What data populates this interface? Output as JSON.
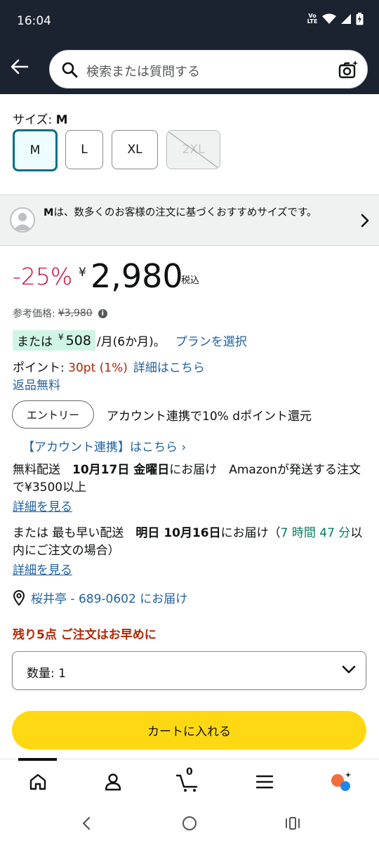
{
  "status_bar": {
    "time": "16:04",
    "volte_line1": "Vo",
    "volte_line2": "LTE"
  },
  "search": {
    "placeholder": "検索または質問する"
  },
  "size": {
    "label_prefix": "サイズ: ",
    "selected": "M",
    "options": [
      {
        "label": "M",
        "state": "selected"
      },
      {
        "label": "L",
        "state": "available"
      },
      {
        "label": "XL",
        "state": "available"
      },
      {
        "label": "2XL",
        "state": "unavailable"
      }
    ]
  },
  "recommendation": {
    "size": "M",
    "text": "は、数多くのお客様の注文に基づくおすすめサイズです。"
  },
  "price": {
    "discount": "-25%",
    "currency": "¥",
    "amount": "2,980",
    "tax": "税込",
    "list_label": "参考価格:",
    "list_price": "¥3,980"
  },
  "installment": {
    "prefix": "または",
    "currency": "¥",
    "amount": "508",
    "suffix": "/月(6か月)。",
    "plan_link": "プランを選択"
  },
  "points": {
    "label": "ポイント: ",
    "value": "30pt  (1%)",
    "link": "詳細はこちら"
  },
  "returns": "返品無料",
  "entry": {
    "button": "エントリー",
    "text": "アカウント連携で10% dポイント還元",
    "link": "【アカウント連携】はこちら ›"
  },
  "delivery": {
    "standard_prefix": "無料配送　",
    "standard_date": "10月17日 金曜日",
    "standard_suffix": "にお届け　Amazonが発送する注文で¥3500以上",
    "standard_link": "詳細を見る",
    "fast_prefix": "または 最も早い配送　",
    "fast_date": "明日 10月16日",
    "fast_mid": "にお届け（",
    "fast_time": "7 時間 47 分",
    "fast_suffix": "以内にご注文の場合）",
    "fast_link": "詳細を見る"
  },
  "location": "桜井亭 - 689-0602 にお届け",
  "stock": "残り5点 ご注文はお早めに",
  "quantity": {
    "label": "数量: 1"
  },
  "cart_button": "カートに入れる",
  "bottom_nav": {
    "cart_count": "0"
  },
  "colors": {
    "accent": "#007185",
    "price_red": "#cc0c39",
    "link": "#2162a1",
    "cart_yellow": "#ffd814",
    "header": "#1b2330"
  }
}
